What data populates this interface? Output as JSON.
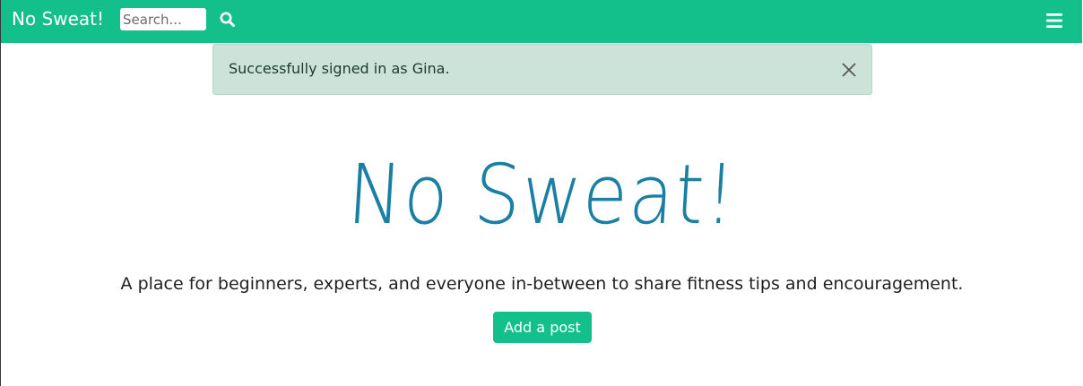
{
  "navbar": {
    "brand": "No Sweat!",
    "search_placeholder": "Search...",
    "search_icon": "search-icon",
    "menu_icon": "hamburger-menu-icon",
    "background_color": "#13c08b"
  },
  "alert": {
    "message": "Successfully signed in as Gina.",
    "close_icon": "close-icon",
    "background_color": "#cce3da"
  },
  "hero": {
    "title": "No Sweat!",
    "subtitle": "A place for beginners, experts, and everyone in-between to share fitness tips and encouragement.",
    "title_color": "#1a7fa3",
    "button_label": "Add a post"
  }
}
